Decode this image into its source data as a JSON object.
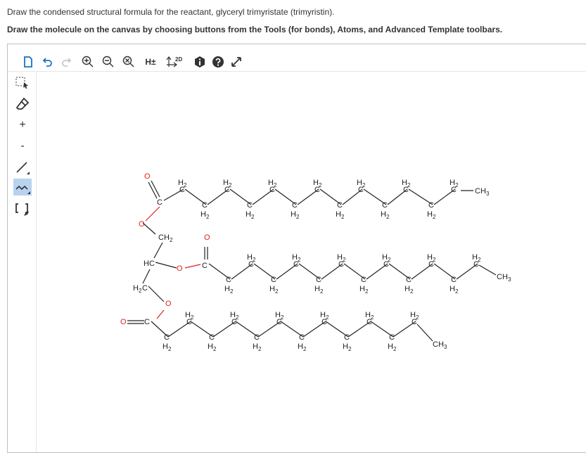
{
  "question": {
    "line1": "Draw the condensed structural formula for the reactant, glyceryl trimyristate (trimyristin).",
    "line2": "Draw the molecule on the canvas by choosing buttons from the Tools (for bonds), Atoms, and Advanced Template toolbars."
  },
  "toolbar": {
    "hydrogen_label": "H±",
    "twod_label": "2D",
    "icons": [
      "new-document-icon",
      "undo-icon",
      "redo-icon",
      "zoom-in-icon",
      "zoom-out-icon",
      "clear-icon",
      "hydrogen-toggle-icon",
      "clean-2d-icon",
      "info-icon",
      "help-icon",
      "fullscreen-icon"
    ]
  },
  "sidebar": {
    "plus_label": "+",
    "minus_label": "-",
    "icons": [
      "selection-icon",
      "eraser-icon",
      "plus-charge-icon",
      "minus-charge-icon",
      "single-bond-icon",
      "chain-icon",
      "bracket-icon"
    ]
  },
  "molecule": {
    "labels": {
      "O": "O",
      "C": "C",
      "H": "H",
      "two": "2",
      "three": "3",
      "CH": "CH",
      "HC": "HC"
    }
  },
  "colors": {
    "accent": "#b7d3ef",
    "oxygen": "#e02020",
    "bond": "#222222"
  }
}
